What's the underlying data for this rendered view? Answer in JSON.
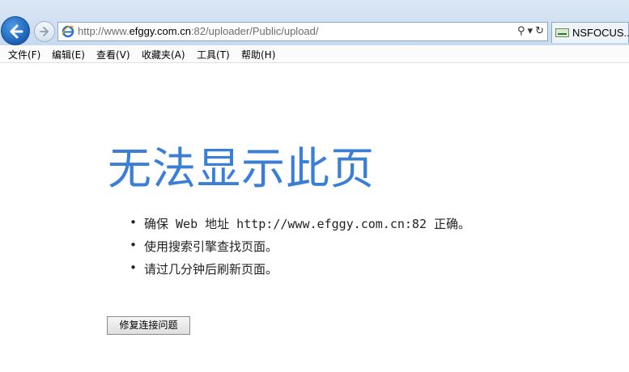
{
  "browser": {
    "url_prefix": "http://www.",
    "url_host": "efggy.com.cn",
    "url_rest": ":82/uploader/Public/upload/",
    "tab_title": "NSFOCUS...",
    "address_tools": {
      "search": "⚲",
      "dropdown": "▾",
      "refresh": "↻"
    }
  },
  "menu": {
    "items": [
      {
        "label": "文件(F)"
      },
      {
        "label": "编辑(E)"
      },
      {
        "label": "查看(V)"
      },
      {
        "label": "收藏夹(A)"
      },
      {
        "label": "工具(T)"
      },
      {
        "label": "帮助(H)"
      }
    ]
  },
  "error_page": {
    "title": "无法显示此页",
    "tips": [
      "确保 Web 地址 http://www.efggy.com.cn:82 正确。",
      "使用搜索引擎查找页面。",
      "请过几分钟后刷新页面。"
    ],
    "fix_button_label": "修复连接问题"
  },
  "colors": {
    "title": "#3a7fd5",
    "back_button": "#1a5fb4"
  },
  "icons": {
    "back": "back-arrow-icon",
    "forward": "forward-arrow-icon",
    "ie": "ie-logo-icon",
    "search": "search-icon",
    "refresh": "refresh-icon",
    "favicon": "tab-favicon-icon"
  }
}
